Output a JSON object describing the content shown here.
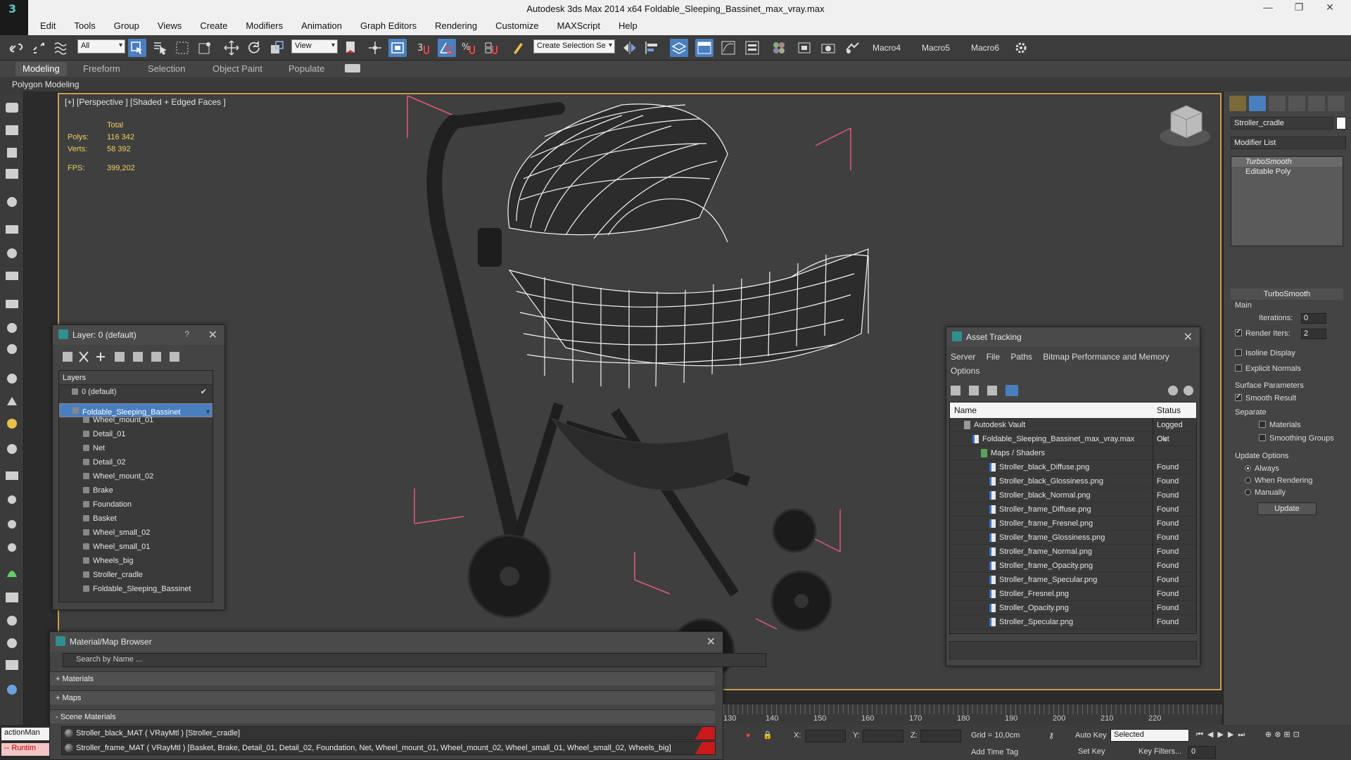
{
  "titlebar": {
    "title": "Autodesk 3ds Max  2014 x64     Foldable_Sleeping_Bassinet_max_vray.max",
    "minimize": "—",
    "maximize": "❐",
    "close": "✕"
  },
  "menubar": {
    "items": [
      "Edit",
      "Tools",
      "Group",
      "Views",
      "Create",
      "Modifiers",
      "Animation",
      "Graph Editors",
      "Rendering",
      "Customize",
      "MAXScript",
      "Help"
    ]
  },
  "toolbar": {
    "selection_filter": "All",
    "ref_coord": "View",
    "named_selection_placeholder": "Create Selection Se",
    "macros": [
      "Macro4",
      "Macro5",
      "Macro6"
    ]
  },
  "ribbon": {
    "tabs": [
      "Modeling",
      "Freeform",
      "Selection",
      "Object Paint",
      "Populate"
    ],
    "sub_label": "Polygon Modeling"
  },
  "viewport": {
    "label": "[+] [Perspective ] [Shaded + Edged Faces ]",
    "stats": {
      "total_label": "Total",
      "polys_label": "Polys:",
      "polys_value": "116 342",
      "verts_label": "Verts:",
      "verts_value": "58 392",
      "fps_label": "FPS:",
      "fps_value": "399,202"
    }
  },
  "cmdpanel": {
    "object_name": "Stroller_cradle",
    "modifier_list": "Modifier List",
    "stack": [
      "TurboSmooth",
      "Editable Poly"
    ],
    "turbosmooth": {
      "title": "TurboSmooth",
      "main": "Main",
      "iterations_label": "Iterations:",
      "iterations_value": "0",
      "render_iters_label": "Render Iters:",
      "render_iters_value": "2",
      "isoline": "Isoline Display",
      "explicit": "Explicit Normals",
      "surface_params": "Surface Parameters",
      "smooth_result": "Smooth Result",
      "separate": "Separate",
      "materials": "Materials",
      "smoothing_groups": "Smoothing Groups",
      "update_options": "Update Options",
      "always": "Always",
      "when_rendering": "When Rendering",
      "manually": "Manually",
      "update_button": "Update"
    }
  },
  "layer_panel": {
    "title": "Layer: 0 (default)",
    "help": "?",
    "close": "✕",
    "header": "Layers",
    "rows": [
      {
        "name": "0 (default)",
        "indent": 0
      },
      {
        "name": "Foldable_Sleeping_Bassinet",
        "indent": 0,
        "selected": true
      },
      {
        "name": "Wheel_mount_01",
        "indent": 1
      },
      {
        "name": "Detail_01",
        "indent": 1
      },
      {
        "name": "Net",
        "indent": 1
      },
      {
        "name": "Detail_02",
        "indent": 1
      },
      {
        "name": "Wheel_mount_02",
        "indent": 1
      },
      {
        "name": "Brake",
        "indent": 1
      },
      {
        "name": "Foundation",
        "indent": 1
      },
      {
        "name": "Basket",
        "indent": 1
      },
      {
        "name": "Wheel_small_02",
        "indent": 1
      },
      {
        "name": "Wheel_small_01",
        "indent": 1
      },
      {
        "name": "Wheels_big",
        "indent": 1
      },
      {
        "name": "Stroller_cradle",
        "indent": 1
      },
      {
        "name": "Foldable_Sleeping_Bassinet",
        "indent": 1
      }
    ]
  },
  "asset_panel": {
    "title": "Asset Tracking",
    "menu": [
      "Server",
      "File",
      "Paths",
      "Bitmap Performance and Memory",
      "Options"
    ],
    "col_name": "Name",
    "col_status": "Status",
    "rows": [
      {
        "name": "Autodesk Vault",
        "status": "Logged Out",
        "indent": 1
      },
      {
        "name": "Foldable_Sleeping_Bassinet_max_vray.max",
        "status": "Ok",
        "indent": 2
      },
      {
        "name": "Maps / Shaders",
        "status": "",
        "indent": 3
      },
      {
        "name": "Stroller_black_Diffuse.png",
        "status": "Found",
        "indent": 4
      },
      {
        "name": "Stroller_black_Glossiness.png",
        "status": "Found",
        "indent": 4
      },
      {
        "name": "Stroller_black_Normal.png",
        "status": "Found",
        "indent": 4
      },
      {
        "name": "Stroller_frame_Diffuse.png",
        "status": "Found",
        "indent": 4
      },
      {
        "name": "Stroller_frame_Fresnel.png",
        "status": "Found",
        "indent": 4
      },
      {
        "name": "Stroller_frame_Glossiness.png",
        "status": "Found",
        "indent": 4
      },
      {
        "name": "Stroller_frame_Normal.png",
        "status": "Found",
        "indent": 4
      },
      {
        "name": "Stroller_frame_Opacity.png",
        "status": "Found",
        "indent": 4
      },
      {
        "name": "Stroller_frame_Specular.png",
        "status": "Found",
        "indent": 4
      },
      {
        "name": "Stroller_Fresnel.png",
        "status": "Found",
        "indent": 4
      },
      {
        "name": "Stroller_Opacity.png",
        "status": "Found",
        "indent": 4
      },
      {
        "name": "Stroller_Specular.png",
        "status": "Found",
        "indent": 4
      }
    ]
  },
  "material_panel": {
    "title": "Material/Map Browser",
    "search_placeholder": "Search by Name ...",
    "groups": [
      "+ Materials",
      "+ Maps",
      "- Scene Materials"
    ],
    "materials": [
      "Stroller_black_MAT  ( VRayMtl )  [Stroller_cradle]",
      "Stroller_frame_MAT  ( VRayMtl )  [Basket, Brake, Detail_01, Detail_02, Foundation, Net, Wheel_mount_01, Wheel_mount_02, Wheel_small_01, Wheel_small_02, Wheels_big]"
    ]
  },
  "timeline": {
    "ticks": [
      "130",
      "140",
      "150",
      "160",
      "170",
      "180",
      "190",
      "200",
      "210",
      "220"
    ]
  },
  "status": {
    "x_label": "X:",
    "y_label": "Y:",
    "z_label": "Z:",
    "grid": "Grid = 10,0cm",
    "auto_key": "Auto Key",
    "set_key": "Set Key",
    "selected": "Selected",
    "key_filters": "Key Filters...",
    "add_time_tag": "Add Time Tag",
    "frame": "0"
  },
  "maxscript": {
    "line1": "actionMan",
    "line2": "-- Runtim"
  }
}
